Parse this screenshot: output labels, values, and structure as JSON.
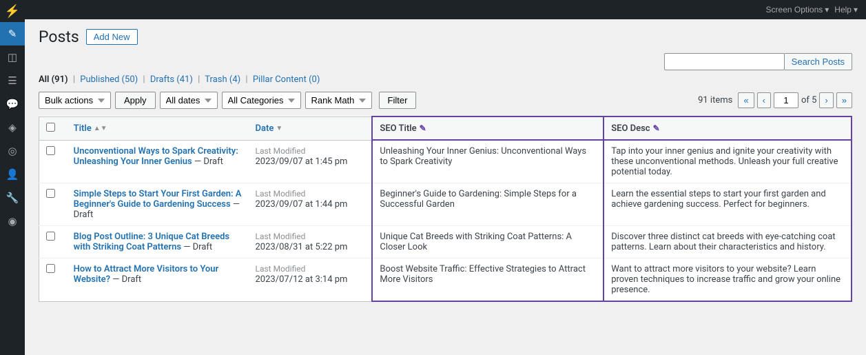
{
  "topbar": {
    "screen_options": "Screen Options",
    "help": "Help"
  },
  "page": {
    "title": "Posts",
    "add_new": "Add New"
  },
  "search": {
    "placeholder": "",
    "button": "Search Posts"
  },
  "filter_links": [
    {
      "label": "All",
      "count": "91",
      "active": true
    },
    {
      "label": "Published",
      "count": "50",
      "active": false
    },
    {
      "label": "Drafts",
      "count": "41",
      "active": false
    },
    {
      "label": "Trash",
      "count": "4",
      "active": false
    },
    {
      "label": "Pillar Content",
      "count": "0",
      "active": false
    }
  ],
  "toolbar": {
    "bulk_actions": "Bulk actions",
    "all_dates": "All dates",
    "all_categories": "All Categories",
    "rank_math": "Rank Math",
    "apply": "Apply",
    "filter": "Filter",
    "total_items": "91 items",
    "page_current": "1",
    "page_total": "5"
  },
  "table": {
    "columns": {
      "title": "Title",
      "date": "Date",
      "seo_title": "SEO Title",
      "seo_desc": "SEO Desc"
    },
    "rows": [
      {
        "title": "Unconventional Ways to Spark Creativity: Unleashing Your Inner Genius",
        "status": "Draft",
        "date_label": "Last Modified",
        "date_value": "2023/09/07 at 1:45 pm",
        "seo_title": "Unleashing Your Inner Genius: Unconventional Ways to Spark Creativity",
        "seo_desc": "Tap into your inner genius and ignite your creativity with these unconventional methods. Unleash your full creative potential today."
      },
      {
        "title": "Simple Steps to Start Your First Garden: A Beginner's Guide to Gardening Success",
        "status": "Draft",
        "date_label": "Last Modified",
        "date_value": "2023/09/07 at 1:44 pm",
        "seo_title": "Beginner's Guide to Gardening: Simple Steps for a Successful Garden",
        "seo_desc": "Learn the essential steps to start your first garden and achieve gardening success. Perfect for beginners."
      },
      {
        "title": "Blog Post Outline: 3 Unique Cat Breeds with Striking Coat Patterns",
        "status": "Draft",
        "date_label": "Last Modified",
        "date_value": "2023/08/31 at 5:22 pm",
        "seo_title": "Unique Cat Breeds with Striking Coat Patterns: A Closer Look",
        "seo_desc": "Discover three distinct cat breeds with eye-catching coat patterns. Learn about their characteristics and history."
      },
      {
        "title": "How to Attract More Visitors to Your Website?",
        "status": "Draft",
        "date_label": "Last Modified",
        "date_value": "2023/07/12 at 3:14 pm",
        "seo_title": "Boost Website Traffic: Effective Strategies to Attract More Visitors",
        "seo_desc": "Want to attract more visitors to your website? Learn proven techniques to increase traffic and grow your online presence."
      }
    ]
  },
  "sidebar": {
    "items": [
      {
        "icon": "⚡",
        "label": "Dashboard"
      },
      {
        "icon": "✎",
        "label": "Posts",
        "active": true
      },
      {
        "icon": "◫",
        "label": "Media"
      },
      {
        "icon": "☰",
        "label": "Pages"
      },
      {
        "icon": "💬",
        "label": "Comments"
      },
      {
        "icon": "◈",
        "label": "Analytics"
      },
      {
        "icon": "◎",
        "label": "SEO"
      },
      {
        "icon": "👤",
        "label": "Users"
      },
      {
        "icon": "🔧",
        "label": "Tools"
      },
      {
        "icon": "◉",
        "label": "More"
      }
    ]
  }
}
